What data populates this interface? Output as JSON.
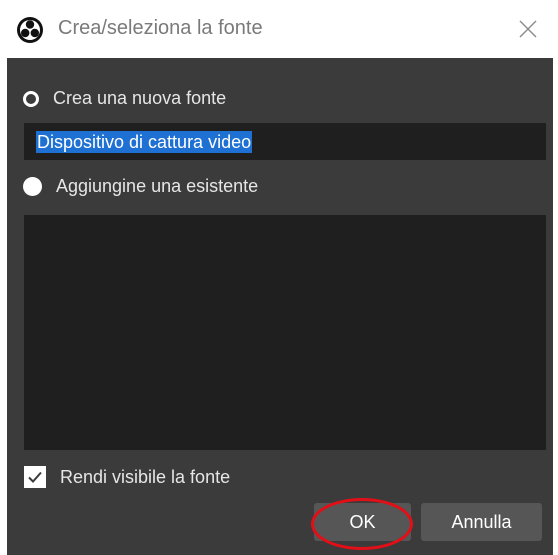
{
  "window": {
    "title": "Crea/seleziona la fonte"
  },
  "options": {
    "create_new_label": "Crea una nuova fonte",
    "source_name_value": "Dispositivo di cattura video",
    "add_existing_label": "Aggiungine una esistente",
    "existing_sources": []
  },
  "visibility": {
    "label": "Rendi visibile la fonte",
    "checked": true
  },
  "buttons": {
    "ok_label": "OK",
    "cancel_label": "Annulla"
  },
  "colors": {
    "dialog_bg": "#3b3b3b",
    "field_bg": "#1f1f1f",
    "selection": "#1e70d3",
    "button_bg": "#565656",
    "highlight_ring": "#e20f17"
  }
}
